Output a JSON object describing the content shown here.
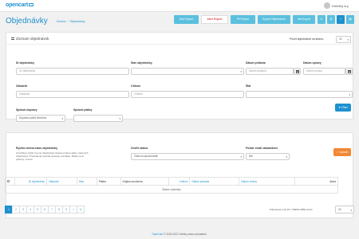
{
  "header": {
    "logo": "opencart",
    "user_name": "Dôležitý kuj"
  },
  "page": {
    "title": "Objednávky",
    "breadcrumb": [
      "Domov",
      "Objednávky"
    ]
  },
  "toolbar": [
    {
      "label": "Ulož Export",
      "style": "t-cyan"
    },
    {
      "label": "Abel Export",
      "style": "t-white"
    },
    {
      "label": "PH Export",
      "style": "t-cyan"
    },
    {
      "label": "Export Objednávok",
      "style": "t-cyan"
    },
    {
      "label": "Sta Export",
      "style": "t-cyan"
    },
    {
      "label": "⟳",
      "style": "t-cyan"
    },
    {
      "label": "⚙",
      "style": "t-cyan"
    },
    {
      "label": "+",
      "style": "t-blue"
    },
    {
      "label": "▤",
      "style": "t-cyan"
    }
  ],
  "list_panel": {
    "title": "Zoznam objednávok",
    "per_page_label": "Počet objednávok na stranu:",
    "per_page_value": "20"
  },
  "filters": {
    "order_id": {
      "label": "ID objednávky",
      "placeholder": "ID objednávky"
    },
    "order_status": {
      "label": "Stav objednávky",
      "value": ""
    },
    "date_added": {
      "label": "Dátum pridania",
      "placeholder": "Dátum pridania"
    },
    "date_modified": {
      "label": "Dátum úpravy",
      "placeholder": "Dátum úpravy"
    },
    "customer": {
      "label": "Zákazník",
      "placeholder": "Zákazník"
    },
    "total": {
      "label": "Celkom",
      "placeholder": "Celkom"
    },
    "tag": {
      "label": "Štát",
      "value": ""
    },
    "shipping": {
      "label": "Spôsob dopravy",
      "value": "Doprava podľa hmotnos"
    },
    "payment": {
      "label": "Spôsob platby",
      "value": ""
    },
    "filter_button": "▼ Filter"
  },
  "bulk_panel": {
    "title": "Rýchla zmena stavu objednávky",
    "help": "Umožňuje rýchlu zmenu objednávky statusu priamo alebo viacerých objednávok. Predvolená metóda spracuje pomalšie. Buďte na to opatrný. zmeniť.",
    "status_label": "Zvoľte status",
    "status_value": "Čaká na spracovanie",
    "notify_label": "Poslať email zákazníkovi",
    "notify_value": "Nie",
    "update_button": "✓ Upravit"
  },
  "table": {
    "headers": [
      "",
      "ID objednávky",
      "Zákazník",
      "Stav",
      "Platba",
      "Krajina doručenia",
      "Celkom",
      "Dátum pridania",
      "Dátum zmeny",
      "Akcia"
    ],
    "empty": "Žiadne výsledky!"
  },
  "pagination": {
    "pages": [
      "1",
      "2",
      "3",
      "4",
      "5",
      "6",
      "7",
      "8",
      "9",
      ">",
      ">|"
    ],
    "results": "Zobrazené 1 až 20 z 36999 (1850 strán)",
    "per_page": "20"
  },
  "footer": {
    "link": "OpenCart",
    "text": " © 2009-2022 Všetky práva vyhradené."
  }
}
